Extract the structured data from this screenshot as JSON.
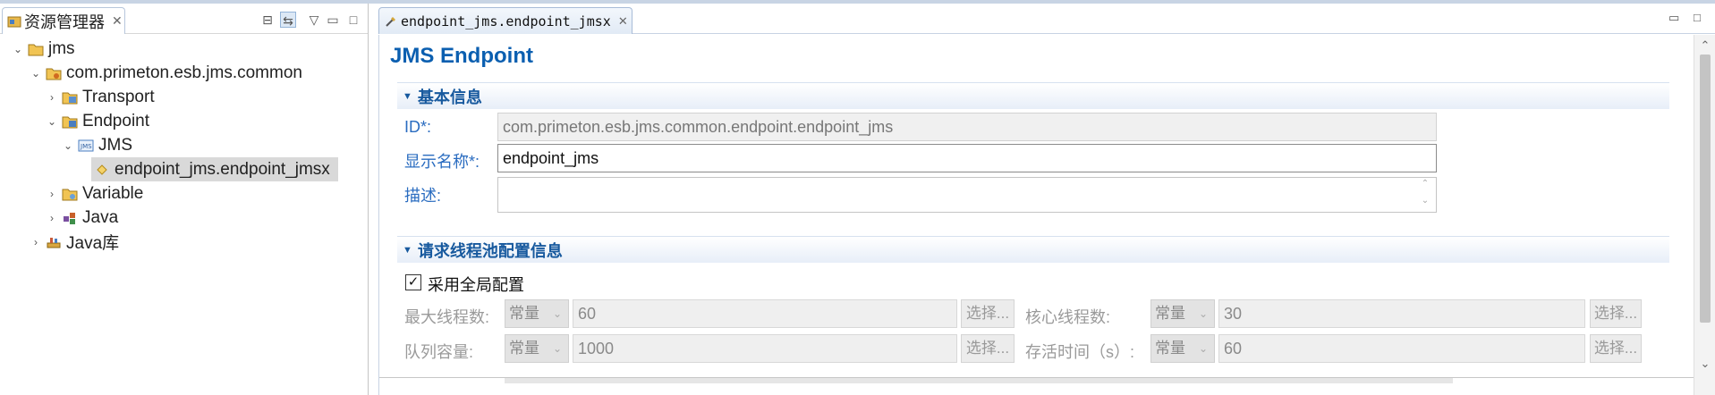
{
  "explorer": {
    "tab_label": "资源管理器",
    "tree": [
      {
        "label": "jms",
        "level": 0,
        "expanded": true,
        "icon": "project-folder-icon"
      },
      {
        "label": "com.primeton.esb.jms.common",
        "level": 1,
        "expanded": true,
        "icon": "module-icon"
      },
      {
        "label": "Transport",
        "level": 2,
        "expanded": false,
        "icon": "transport-folder-icon"
      },
      {
        "label": "Endpoint",
        "level": 2,
        "expanded": true,
        "icon": "endpoint-folder-icon"
      },
      {
        "label": "JMS",
        "level": 3,
        "expanded": true,
        "icon": "jms-icon"
      },
      {
        "label": "endpoint_jms.endpoint_jmsx",
        "level": 4,
        "expanded": null,
        "icon": "endpoint-file-icon",
        "selected": true
      },
      {
        "label": "Variable",
        "level": 2,
        "expanded": false,
        "icon": "variable-folder-icon"
      },
      {
        "label": "Java",
        "level": 2,
        "expanded": false,
        "icon": "java-package-icon"
      },
      {
        "label": "Java库",
        "level": 1,
        "expanded": false,
        "icon": "java-library-icon"
      }
    ]
  },
  "editor": {
    "tab_label": "endpoint_jms.endpoint_jmsx",
    "title": "JMS Endpoint",
    "basic": {
      "heading": "基本信息",
      "id_label": "ID*:",
      "id_value": "com.primeton.esb.jms.common.endpoint.endpoint_jms",
      "name_label": "显示名称*:",
      "name_value": "endpoint_jms",
      "desc_label": "描述:",
      "desc_value": ""
    },
    "threadpool": {
      "heading": "请求线程池配置信息",
      "use_global_label": "采用全局配置",
      "use_global_checked": "✓",
      "max_threads_label": "最大线程数:",
      "max_threads_type": "常量",
      "max_threads_value": "60",
      "core_threads_label": "核心线程数:",
      "core_threads_type": "常量",
      "core_threads_value": "30",
      "queue_label": "队列容量:",
      "queue_type": "常量",
      "queue_value": "1000",
      "keepalive_label": "存活时间（s）:",
      "keepalive_type": "常量",
      "keepalive_value": "60",
      "choose_label": "选择..."
    }
  }
}
